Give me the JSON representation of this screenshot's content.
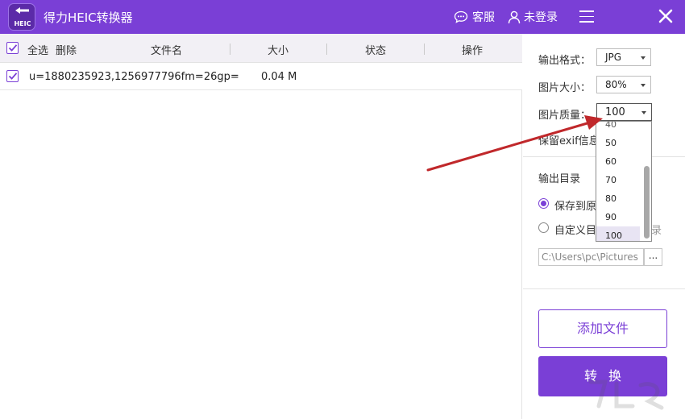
{
  "titlebar": {
    "logo_text": "HEIC",
    "app_title": "得力HEIC转换器",
    "service_label": "客服",
    "login_label": "未登录"
  },
  "list": {
    "header": {
      "select_all": "全选",
      "delete": "删除",
      "filename": "文件名",
      "size": "大小",
      "status": "状态",
      "actions": "操作"
    },
    "rows": [
      {
        "name": "u=1880235923,1256977796fm=26gp=",
        "size": "0.04 M",
        "status": "",
        "checked": true
      }
    ]
  },
  "settings": {
    "format_label": "输出格式：",
    "format_value": "JPG",
    "size_label": "图片大小：",
    "size_value": "80%",
    "quality_label": "图片质量：",
    "quality_value": "100",
    "exif_label": "保留exif信息",
    "output_dir_title": "输出目录",
    "option_same": "保存到原",
    "option_custom": "自定义目",
    "option_custom_tail": "录",
    "path_value": "C:\\Users\\pc\\Pictures",
    "browse_label": "...",
    "add_file_label": "添加文件",
    "convert_label": "转换"
  },
  "quality_dropdown": {
    "partial_item": "40",
    "items": [
      "50",
      "60",
      "70",
      "80",
      "90",
      "100"
    ],
    "selected": "100"
  },
  "colors": {
    "accent": "#7a3fd6",
    "arrow": "#c0282b"
  }
}
